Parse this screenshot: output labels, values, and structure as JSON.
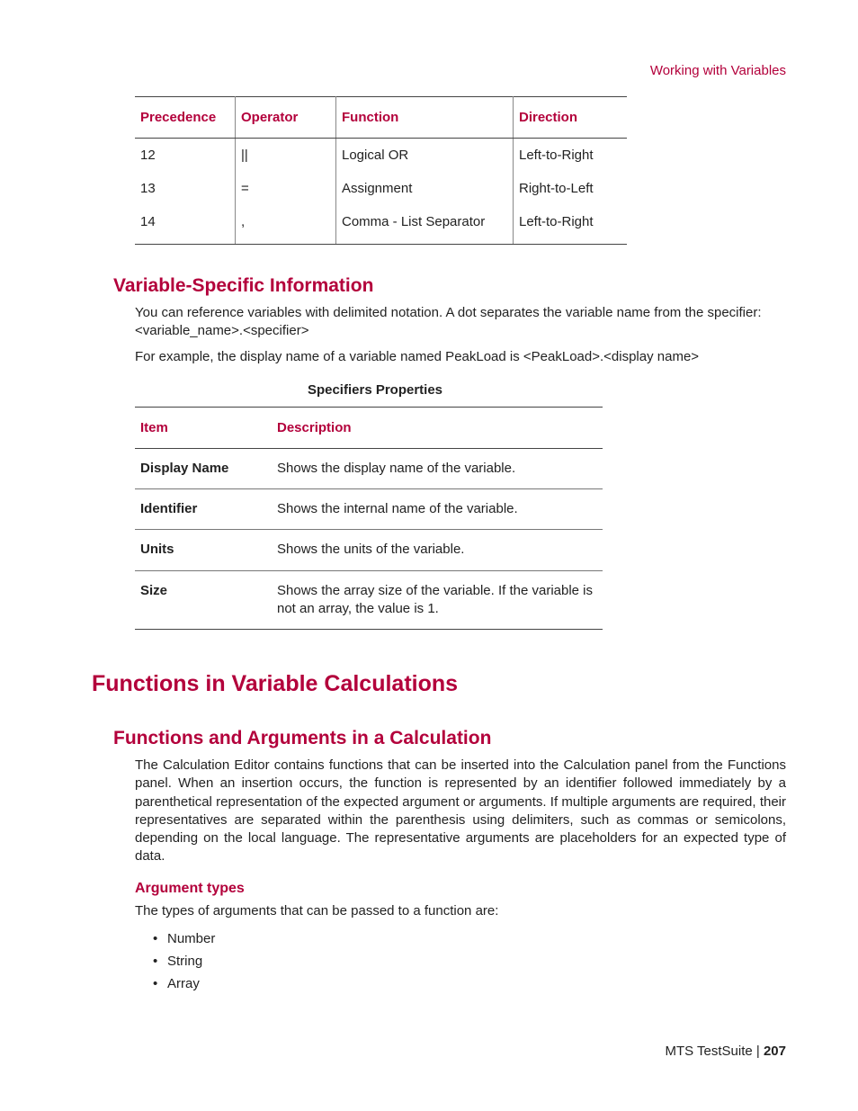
{
  "header": {
    "breadcrumb": "Working with Variables"
  },
  "table_precedence": {
    "headers": {
      "precedence": "Precedence",
      "operator": "Operator",
      "function": "Function",
      "direction": "Direction"
    },
    "rows": [
      {
        "precedence": "12",
        "operator": "||",
        "function": "Logical OR",
        "direction": "Left-to-Right"
      },
      {
        "precedence": "13",
        "operator": "=",
        "function": "Assignment",
        "direction": "Right-to-Left"
      },
      {
        "precedence": "14",
        "operator": ",",
        "function": "Comma - List Separator",
        "direction": "Left-to-Right"
      }
    ]
  },
  "section_varspec": {
    "title": "Variable-Specific Information",
    "p1": "You can reference variables with delimited notation. A dot separates the variable name from the specifier: <variable_name>.<specifier>",
    "p2": "For example, the display name of a variable named PeakLoad is <PeakLoad>.<display name>",
    "table_caption": "Specifiers Properties",
    "headers": {
      "item": "Item",
      "description": "Description"
    },
    "rows": [
      {
        "item": "Display Name",
        "description": "Shows the display name of the variable."
      },
      {
        "item": "Identifier",
        "description": "Shows the internal name of the variable."
      },
      {
        "item": "Units",
        "description": "Shows the units of the variable."
      },
      {
        "item": "Size",
        "description": "Shows the array size of the variable. If the variable is not an array, the value is 1."
      }
    ]
  },
  "section_functions": {
    "title": "Functions in Variable Calculations",
    "sub_title": "Functions and Arguments in a Calculation",
    "p1": "The Calculation Editor contains functions that can be inserted into the Calculation panel from the Functions panel. When an insertion occurs, the function is represented by an identifier followed immediately by a parenthetical representation of the expected argument or arguments. If multiple arguments are required, their representatives are separated within the parenthesis using delimiters, such as commas or semicolons, depending on the local language. The representative arguments are placeholders for an expected type of data.",
    "argtypes_heading": "Argument types",
    "argtypes_intro": "The types of arguments that can be passed to a function are:",
    "argtypes": [
      "Number",
      "String",
      "Array"
    ]
  },
  "footer": {
    "product": "MTS TestSuite",
    "sep": " | ",
    "page": "207"
  }
}
